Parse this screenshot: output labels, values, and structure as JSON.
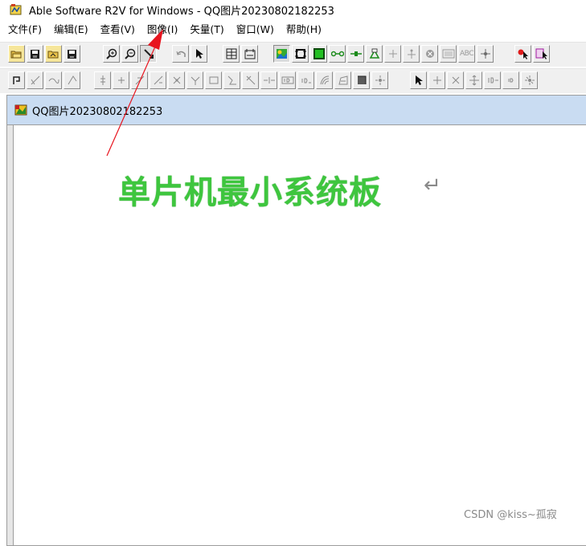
{
  "window": {
    "title": "Able Software R2V for Windows - QQ图片20230802182253",
    "icon": "r2v-app-icon"
  },
  "menu": {
    "items": [
      {
        "label": "文件(F)"
      },
      {
        "label": "编辑(E)"
      },
      {
        "label": "查看(V)"
      },
      {
        "label": "图像(I)"
      },
      {
        "label": "矢量(T)"
      },
      {
        "label": "窗口(W)"
      },
      {
        "label": "帮助(H)"
      }
    ]
  },
  "toolbar_row1_labels": {
    "ocr": "ABC"
  },
  "document": {
    "title": "QQ图片20230802182253",
    "icon": "image-document-icon",
    "image_text": "单片机最小系统板",
    "return_mark": "↵"
  },
  "watermark": "CSDN @kiss~孤寂",
  "colors": {
    "image_text": "#3ec63e",
    "doc_titlebar": "#c9dcf2",
    "annotation_arrow": "#e8141e",
    "toolbar_bg": "#f0f0f0"
  }
}
